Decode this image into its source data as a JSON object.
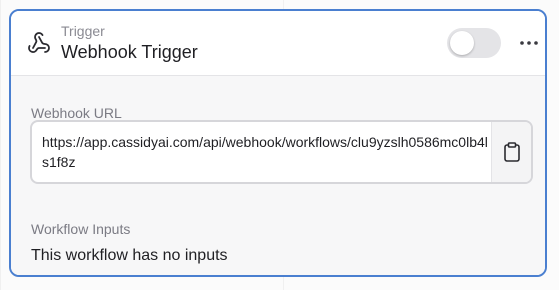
{
  "node": {
    "kicker": "Trigger",
    "title": "Webhook Trigger",
    "icon": "webhook-icon",
    "toggle_enabled": false,
    "more_icon": "more-horizontal-icon"
  },
  "webhook": {
    "label": "Webhook URL",
    "url": "https://app.cassidyai.com/api/webhook/workflows/clu9yzslh0586mc0lb4ls1f8z",
    "copy_icon": "clipboard-icon"
  },
  "inputs": {
    "label": "Workflow Inputs",
    "empty_text": "This workflow has no inputs"
  },
  "colors": {
    "accent_border": "#4a7fd0",
    "toggle_off": "#e4e4e7",
    "muted_text": "#7b7b84"
  }
}
